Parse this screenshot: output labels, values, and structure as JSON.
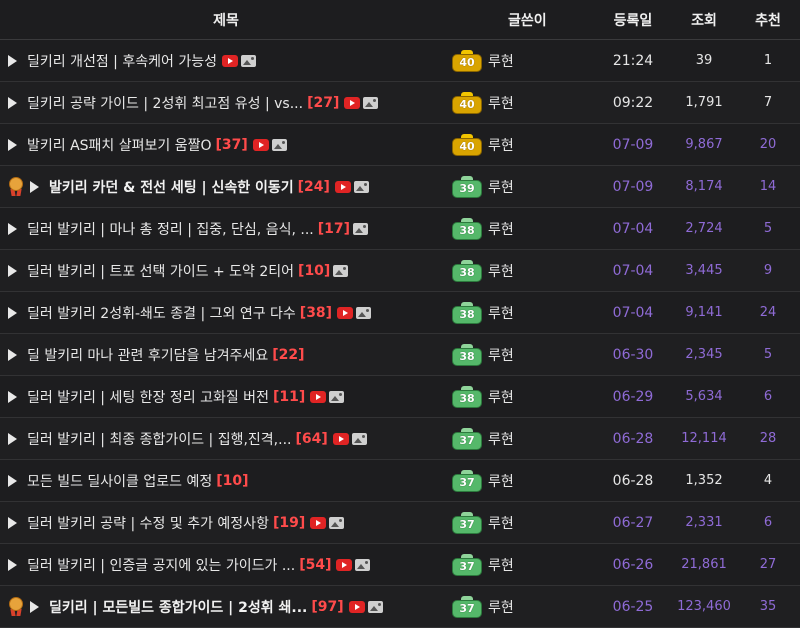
{
  "header": {
    "title": "제목",
    "author": "글쓴이",
    "date": "등록일",
    "views": "조회",
    "rec": "추천"
  },
  "rows": [
    {
      "title": "딜키리 개선점 | 후속케어 가능성",
      "comments": "",
      "video": true,
      "image": true,
      "level": "40",
      "level_color": "gold",
      "author": "루현",
      "date": "21:24",
      "views": "39",
      "rec": "1",
      "today": true,
      "medal": false,
      "bold": false
    },
    {
      "title": "딜키리 공략 가이드 | 2성휘 최고점 유성 | vs...",
      "comments": "[27]",
      "video": true,
      "image": true,
      "level": "40",
      "level_color": "gold",
      "author": "루현",
      "date": "09:22",
      "views": "1,791",
      "rec": "7",
      "today": true,
      "medal": false,
      "bold": false
    },
    {
      "title": "발키리 AS패치 살펴보기 움짤O",
      "comments": "[37]",
      "video": true,
      "image": true,
      "level": "40",
      "level_color": "gold",
      "author": "루현",
      "date": "07-09",
      "views": "9,867",
      "rec": "20",
      "today": false,
      "medal": false,
      "bold": false
    },
    {
      "title": "발키리 카던 & 전선 세팅 | 신속한 이동기",
      "comments": "[24]",
      "video": true,
      "image": true,
      "level": "39",
      "level_color": "green",
      "author": "루현",
      "date": "07-09",
      "views": "8,174",
      "rec": "14",
      "today": false,
      "medal": true,
      "bold": true
    },
    {
      "title": "딜러 발키리 | 마나 총 정리 | 집중, 단심, 음식, ...",
      "comments": "[17]",
      "video": false,
      "image": true,
      "level": "38",
      "level_color": "green",
      "author": "루현",
      "date": "07-04",
      "views": "2,724",
      "rec": "5",
      "today": false,
      "medal": false,
      "bold": false
    },
    {
      "title": "딜러 발키리 | 트포 선택 가이드 + 도약 2티어",
      "comments": "[10]",
      "video": false,
      "image": true,
      "level": "38",
      "level_color": "green",
      "author": "루현",
      "date": "07-04",
      "views": "3,445",
      "rec": "9",
      "today": false,
      "medal": false,
      "bold": false
    },
    {
      "title": "딜러 발키리 2성휘-쇄도 종결 | 그외 연구 다수",
      "comments": "[38]",
      "video": true,
      "image": true,
      "level": "38",
      "level_color": "green",
      "author": "루현",
      "date": "07-04",
      "views": "9,141",
      "rec": "24",
      "today": false,
      "medal": false,
      "bold": false
    },
    {
      "title": "딜 발키리 마나 관련 후기담을 남겨주세요",
      "comments": "[22]",
      "video": false,
      "image": false,
      "level": "38",
      "level_color": "green",
      "author": "루현",
      "date": "06-30",
      "views": "2,345",
      "rec": "5",
      "today": false,
      "medal": false,
      "bold": false
    },
    {
      "title": "딜러 발키리 | 세팅 한장 정리 고화질 버전",
      "comments": "[11]",
      "video": true,
      "image": true,
      "level": "38",
      "level_color": "green",
      "author": "루현",
      "date": "06-29",
      "views": "5,634",
      "rec": "6",
      "today": false,
      "medal": false,
      "bold": false
    },
    {
      "title": "딜러 발키리 | 최종 종합가이드 | 집행,진격,...",
      "comments": "[64]",
      "video": true,
      "image": true,
      "level": "37",
      "level_color": "green",
      "author": "루현",
      "date": "06-28",
      "views": "12,114",
      "rec": "28",
      "today": false,
      "medal": false,
      "bold": false
    },
    {
      "title": "모든 빌드 딜사이클 업로드 예정",
      "comments": "[10]",
      "video": false,
      "image": false,
      "level": "37",
      "level_color": "green",
      "author": "루현",
      "date": "06-28",
      "views": "1,352",
      "rec": "4",
      "today": true,
      "medal": false,
      "bold": false
    },
    {
      "title": "딜러 발키리 공략 | 수정 및 추가 예정사항",
      "comments": "[19]",
      "video": true,
      "image": true,
      "level": "37",
      "level_color": "green",
      "author": "루현",
      "date": "06-27",
      "views": "2,331",
      "rec": "6",
      "today": false,
      "medal": false,
      "bold": false
    },
    {
      "title": "딜러 발키리 | 인증글 공지에 있는 가이드가 ...",
      "comments": "[54]",
      "video": true,
      "image": true,
      "level": "37",
      "level_color": "green",
      "author": "루현",
      "date": "06-26",
      "views": "21,861",
      "rec": "27",
      "today": false,
      "medal": false,
      "bold": false
    },
    {
      "title": "딜키리 | 모든빌드 종합가이드 | 2성휘 쇄...",
      "comments": "[97]",
      "video": true,
      "image": true,
      "level": "37",
      "level_color": "green",
      "author": "루현",
      "date": "06-25",
      "views": "123,460",
      "rec": "35",
      "today": false,
      "medal": true,
      "bold": true
    }
  ],
  "icons": {
    "row_arrow": "play-triangle-icon",
    "medal": "medal-icon",
    "video": "video-icon",
    "image": "image-icon",
    "level_badge": "level-badge-icon"
  },
  "colors": {
    "background": "#1d1d1f",
    "comment": "#ff4b4b",
    "old_date": "#8f6bd6",
    "video": "#e02424",
    "level_gold": "#d9a400",
    "level_green": "#55b86a"
  }
}
